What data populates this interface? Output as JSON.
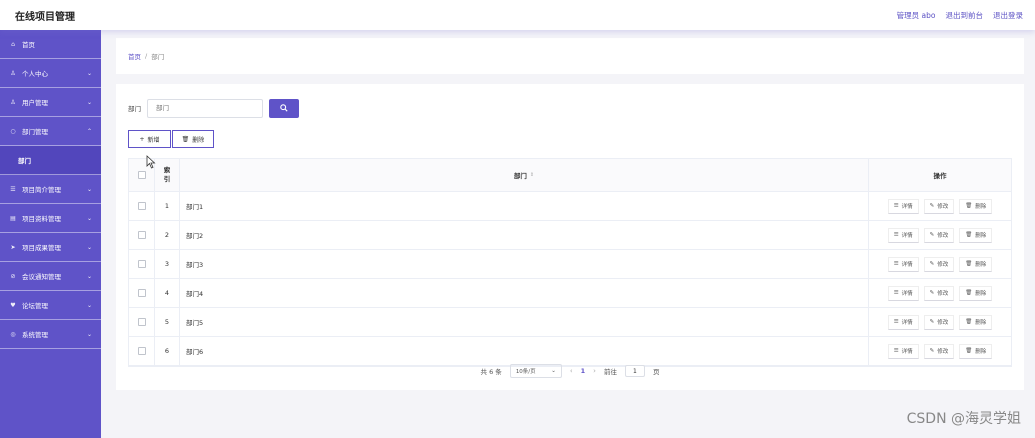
{
  "header": {
    "title": "在线项目管理",
    "admin_label": "管理员 abo",
    "to_front_label": "退出到前台",
    "logout_label": "退出登录"
  },
  "sidebar": {
    "items": [
      {
        "icon": "home-icon",
        "glyph": "⌂",
        "label": "首页",
        "expandable": false
      },
      {
        "icon": "user-icon",
        "glyph": "♙",
        "label": "个人中心",
        "expandable": true
      },
      {
        "icon": "users-icon",
        "glyph": "♙",
        "label": "用户管理",
        "expandable": true
      },
      {
        "icon": "dept-icon",
        "glyph": "○",
        "label": "部门管理",
        "expandable": true,
        "expanded": true
      },
      {
        "icon": "",
        "glyph": "",
        "label": "部门",
        "sub": true
      },
      {
        "icon": "list-icon",
        "glyph": "☰",
        "label": "项目简介管理",
        "expandable": true
      },
      {
        "icon": "doc-icon",
        "glyph": "▤",
        "label": "项目资料管理",
        "expandable": true
      },
      {
        "icon": "send-icon",
        "glyph": "➤",
        "label": "项目成果管理",
        "expandable": true
      },
      {
        "icon": "notice-icon",
        "glyph": "⊘",
        "label": "会议通知管理",
        "expandable": true
      },
      {
        "icon": "forum-icon",
        "glyph": "♥",
        "label": "论坛管理",
        "expandable": true
      },
      {
        "icon": "settings-icon",
        "glyph": "◎",
        "label": "系统管理",
        "expandable": true
      }
    ]
  },
  "breadcrumb": {
    "home": "首页",
    "separator": "/",
    "current": "部门"
  },
  "search": {
    "label": "部门",
    "placeholder": "部门",
    "value": ""
  },
  "toolbar": {
    "add_label": "新增",
    "delete_label": "删除"
  },
  "table": {
    "headers": {
      "index": "索引",
      "name": "部门",
      "actions": "操作"
    },
    "rows": [
      {
        "index": "1",
        "name": "部门1"
      },
      {
        "index": "2",
        "name": "部门2"
      },
      {
        "index": "3",
        "name": "部门3"
      },
      {
        "index": "4",
        "name": "部门4"
      },
      {
        "index": "5",
        "name": "部门5"
      },
      {
        "index": "6",
        "name": "部门6"
      }
    ],
    "row_actions": {
      "detail": "详情",
      "edit": "修改",
      "delete": "删除"
    }
  },
  "pagination": {
    "total_label": "共 6 条",
    "page_size": "10条/页",
    "current_page": "1",
    "goto_prefix": "前往",
    "goto_value": "1",
    "goto_suffix": "页"
  },
  "watermark": "CSDN @海灵学姐",
  "colors": {
    "accent": "#5f53c8",
    "sidebar": "#5f53c8"
  }
}
